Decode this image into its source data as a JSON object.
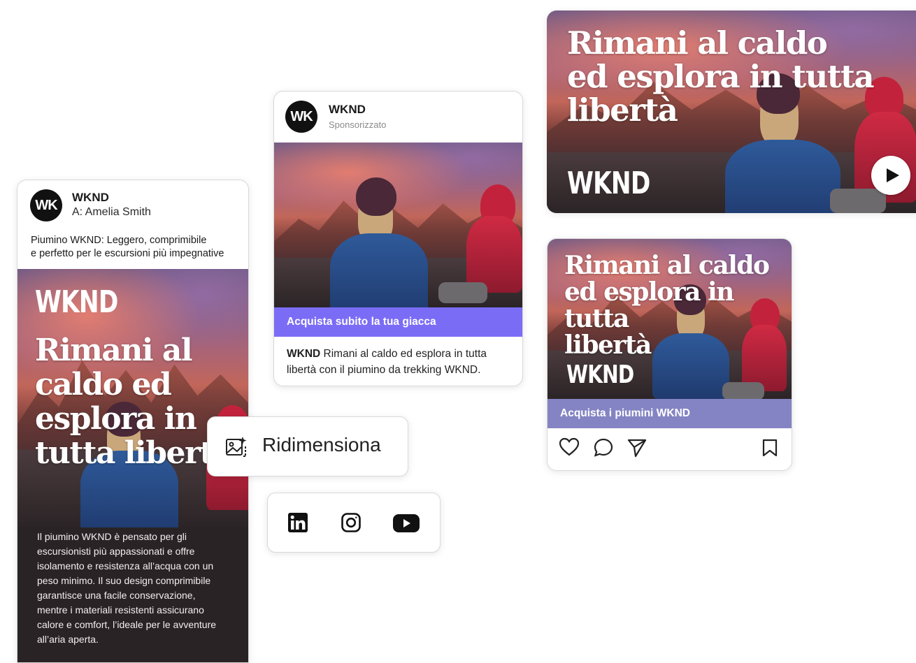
{
  "brand": "WKND",
  "avatar_initials": "WK",
  "email_card": {
    "sender": "WKND",
    "recipient": "A: Amelia Smith",
    "subject_line1": "Piumino WKND: Leggero, comprimibile",
    "subject_line2": "e perfetto per le escursioni più impegnative",
    "headline": [
      "Rimani al",
      "caldo ed",
      "esplora in",
      "tutta libertà"
    ],
    "body_lines": [
      "Il piumino WKND è pensato per gli",
      "escursionisti più appassionati e offre",
      "isolamento e resistenza all’acqua con un",
      "peso minimo. Il suo design comprimibile",
      "garantisce una facile conservazione,",
      "mentre i materiali resistenti assicurano",
      "calore e comfort, l’ideale per le avventure",
      "all’aria aperta."
    ]
  },
  "sponsored_card": {
    "account": "WKND",
    "label": "Sponsorizzato",
    "cta": "Acquista subito la tua giacca",
    "caption_bold": "WKND",
    "caption_rest_line1": " Rimani al caldo ed esplora in tutta",
    "caption_line2": "libertà con il piumino da trekking WKND."
  },
  "video_card": {
    "headline": [
      "Rimani al caldo",
      "ed esplora in tutta",
      "libertà"
    ]
  },
  "social_card": {
    "headline": [
      "Rimani al caldo",
      "ed esplora in tutta",
      "libertà"
    ],
    "cta": "Acquista i piumini WKND"
  },
  "resize_chip": {
    "label": "Ridimensiona"
  },
  "colors": {
    "cta_purple": "#7b6cf6",
    "cta_muted_purple": "#8484c4",
    "email_dark_bg": "#2a2326"
  },
  "icons": [
    "linkedin-icon",
    "instagram-icon",
    "youtube-icon",
    "heart-icon",
    "comment-icon",
    "send-icon",
    "bookmark-icon",
    "play-icon",
    "ai-image-resize-icon"
  ]
}
